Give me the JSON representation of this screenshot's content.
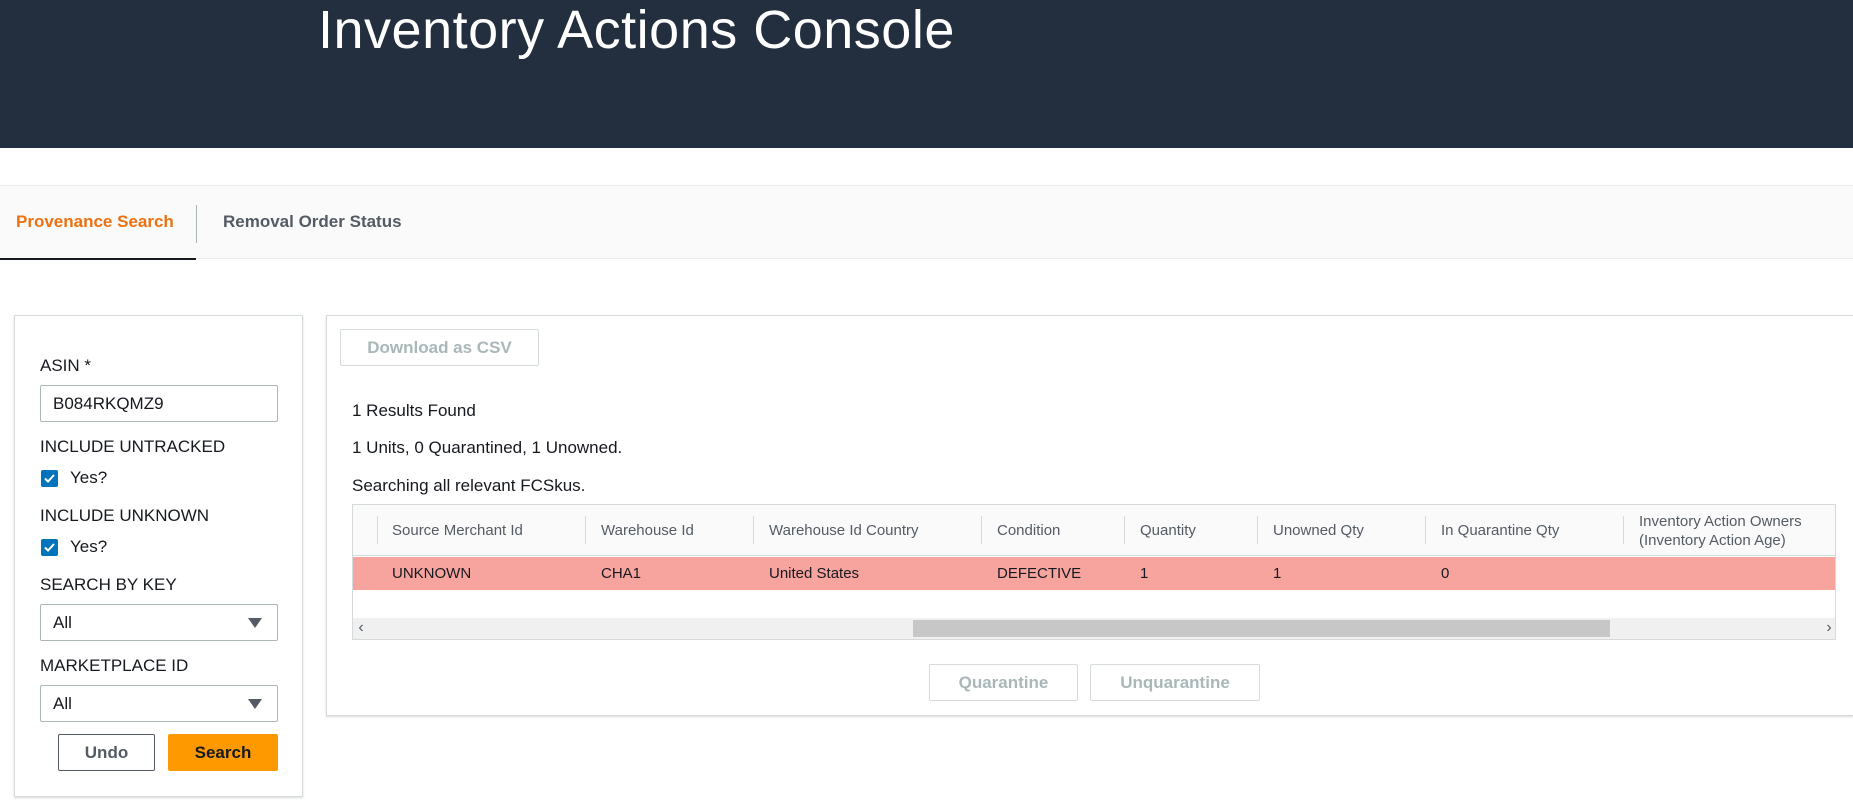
{
  "header": {
    "title": "Inventory Actions Console"
  },
  "tabs": [
    {
      "label": "Provenance Search",
      "active": true
    },
    {
      "label": "Removal Order Status",
      "active": false
    }
  ],
  "filters": {
    "asin_label": "ASIN *",
    "asin_value": "B084RKQMZ9",
    "include_untracked_label": "INCLUDE UNTRACKED",
    "include_untracked_option": "Yes?",
    "include_untracked_checked": true,
    "include_unknown_label": "INCLUDE UNKNOWN",
    "include_unknown_option": "Yes?",
    "include_unknown_checked": true,
    "search_by_key_label": "SEARCH BY KEY",
    "search_by_key_value": "All",
    "marketplace_id_label": "MARKETPLACE ID",
    "marketplace_id_value": "All",
    "undo_label": "Undo",
    "search_label": "Search"
  },
  "results": {
    "download_label": "Download as CSV",
    "results_found": "1 Results Found",
    "summary": "1 Units, 0 Quarantined, 1 Unowned.",
    "searching_text": "Searching all relevant FCSkus.",
    "table": {
      "columns": [
        "Source Merchant Id",
        "Warehouse Id",
        "Warehouse Id Country",
        "Condition",
        "Quantity",
        "Unowned Qty",
        "In Quarantine Qty",
        "Inventory Action Owners (Inventory Action Age)"
      ],
      "rows": [
        [
          "UNKNOWN",
          "CHA1",
          "United States",
          "DEFECTIVE",
          "1",
          "1",
          "0",
          ""
        ]
      ],
      "row_highlight_color": "#f7a49f"
    },
    "quarantine_label": "Quarantine",
    "unquarantine_label": "Unquarantine"
  },
  "colors": {
    "header_bg": "#232f3e",
    "accent": "#ec7211",
    "primary_button": "#ff9900",
    "checkbox": "#0073bb"
  }
}
